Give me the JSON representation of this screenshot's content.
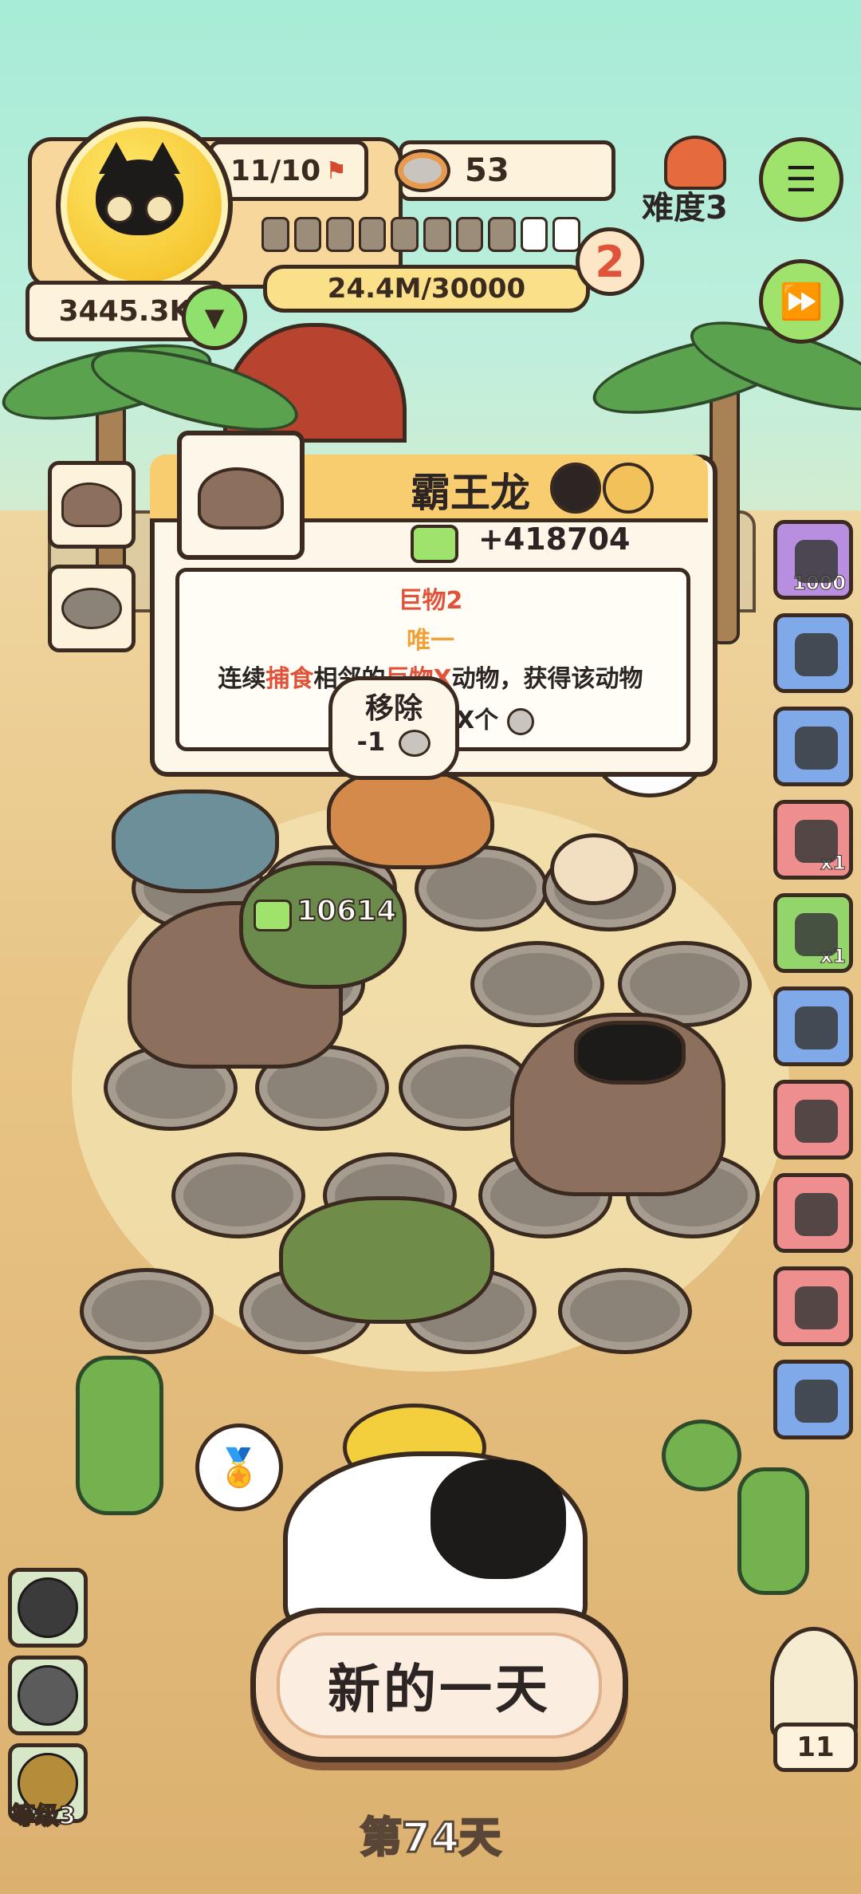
{
  "hud": {
    "capacity": "11/10",
    "cans": "53",
    "difficulty": "难度3",
    "coins": "3445.3K",
    "exp": "24.4M/30000",
    "level_badge": "2",
    "steps_total": 10,
    "steps_filled": 8
  },
  "tooltip": {
    "name": "霸王龙",
    "income": "+418704",
    "tag1": "巨物2",
    "tag2": "唯一",
    "desc_a": "连续",
    "desc_b": "捕食",
    "desc_c": "相邻的",
    "desc_d": "巨物X",
    "desc_e": "动物，获得该动物",
    "desc_f": "X个"
  },
  "remove_bubble": {
    "label": "移除",
    "cost": "-1"
  },
  "floating_income": "10614",
  "sidebar": [
    {
      "icon": "coin-bag-icon",
      "badge": "1000",
      "color": "#b78ee0"
    },
    {
      "icon": "camera-icon",
      "badge": "",
      "color": "#7fa9e8"
    },
    {
      "icon": "jar-icon",
      "badge": "",
      "color": "#7fa9e8"
    },
    {
      "icon": "crystal-icon",
      "badge": "x1",
      "color": "#ef8e8e"
    },
    {
      "icon": "leaf-item-icon",
      "badge": "x1",
      "color": "#93d46b"
    },
    {
      "icon": "loom-icon",
      "badge": "",
      "color": "#7fa9e8"
    },
    {
      "icon": "rope-bundle-icon",
      "badge": "",
      "color": "#ef8e8e"
    },
    {
      "icon": "sack-icon",
      "badge": "",
      "color": "#ef8e8e"
    },
    {
      "icon": "tools-icon",
      "badge": "",
      "color": "#ef8e8e"
    },
    {
      "icon": "can-icon",
      "badge": "",
      "color": "#7fa9e8"
    }
  ],
  "owl_count": "11",
  "bottom_left": {
    "level": "等级3"
  },
  "new_day": "新的一天",
  "day": "第74天",
  "colors": {
    "accent": "#f8cd6f",
    "red_text": "#e0533a",
    "orange_text": "#f0a23a"
  }
}
